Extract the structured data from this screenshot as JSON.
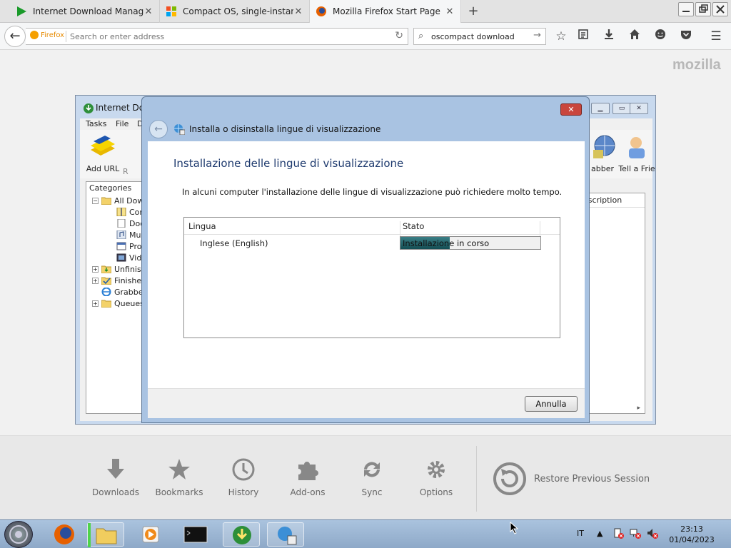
{
  "browser": {
    "tabs": [
      {
        "title": "Internet Download Manage...",
        "active": false
      },
      {
        "title": "Compact OS, single-instanc...",
        "active": false
      },
      {
        "title": "Mozilla Firefox Start Page",
        "active": true
      }
    ],
    "identity_label": "Firefox",
    "url_placeholder": "Search or enter address",
    "search_value": "oscompact download",
    "brand_watermark": "mozilla"
  },
  "idm": {
    "title": "Internet Dow",
    "menu": [
      "Tasks",
      "File",
      "D"
    ],
    "toolbar": {
      "add_url": "Add URL",
      "r_partial": "R",
      "grabber_partial": "abber",
      "tell_friend_partial": "Tell a Frie"
    },
    "categories_header": "Categories",
    "tree": [
      {
        "label": "All Dow",
        "level": 0,
        "expander": "−"
      },
      {
        "label": "Cor",
        "level": 1
      },
      {
        "label": "Doc",
        "level": 1
      },
      {
        "label": "Mus",
        "level": 1
      },
      {
        "label": "Pro",
        "level": 1
      },
      {
        "label": "Vid",
        "level": 1
      },
      {
        "label": "Unfinish",
        "level": 0,
        "expander": "+"
      },
      {
        "label": "Finishe",
        "level": 0,
        "expander": "+"
      },
      {
        "label": "Grabbe",
        "level": 0,
        "expander": ""
      },
      {
        "label": "Queues",
        "level": 0,
        "expander": "+"
      }
    ],
    "description_header": "escription"
  },
  "dialog": {
    "nav_title": "Installa o disinstalla lingue di visualizzazione",
    "heading": "Installazione delle lingue di visualizzazione",
    "description": "In alcuni computer l'installazione delle lingue di visualizzazione può richiedere molto tempo.",
    "columns": [
      "Lingua",
      "Stato"
    ],
    "rows": [
      {
        "language": "Inglese (English)",
        "status": "Installazione in corso",
        "progress": 0.35
      }
    ],
    "cancel_label": "Annulla"
  },
  "launcher": {
    "items": [
      {
        "label": "Downloads",
        "icon": "download-icon"
      },
      {
        "label": "Bookmarks",
        "icon": "star-icon"
      },
      {
        "label": "History",
        "icon": "clock-icon"
      },
      {
        "label": "Add-ons",
        "icon": "puzzle-icon"
      },
      {
        "label": "Sync",
        "icon": "sync-icon"
      },
      {
        "label": "Options",
        "icon": "gear-icon"
      }
    ],
    "restore_label": "Restore Previous Session"
  },
  "taskbar": {
    "language": "IT",
    "time": "23:13",
    "date": "01/04/2023"
  },
  "colors": {
    "dialog_frame": "#a9c3e2",
    "heading_blue": "#1e3a6e",
    "progress_fill": "#1f5a60",
    "close_red": "#c9463d"
  }
}
